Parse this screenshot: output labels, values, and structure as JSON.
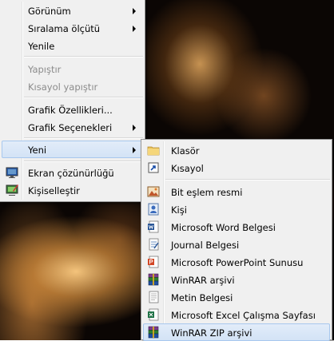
{
  "context_menu": {
    "items": [
      {
        "label": "Görünüm",
        "submenu": true
      },
      {
        "label": "Sıralama ölçütü",
        "submenu": true
      },
      {
        "label": "Yenile"
      },
      {
        "label": "Yapıştır",
        "disabled": true
      },
      {
        "label": "Kısayol yapıştır",
        "disabled": true
      },
      {
        "label": "Grafik Özellikleri..."
      },
      {
        "label": "Grafik Seçenekleri",
        "submenu": true
      },
      {
        "label": "Yeni",
        "submenu": true,
        "highlighted": true
      },
      {
        "label": "Ekran çözünürlüğü",
        "icon": "screen-resolution-icon"
      },
      {
        "label": "Kişiselleştir",
        "icon": "personalize-icon"
      }
    ]
  },
  "new_submenu": {
    "items": [
      {
        "label": "Klasör",
        "icon": "folder-icon"
      },
      {
        "label": "Kısayol",
        "icon": "shortcut-icon"
      },
      {
        "label": "Bit eşlem resmi",
        "icon": "bitmap-image-icon"
      },
      {
        "label": "Kişi",
        "icon": "contact-icon"
      },
      {
        "label": "Microsoft Word Belgesi",
        "icon": "word-document-icon"
      },
      {
        "label": "Journal Belgesi",
        "icon": "journal-document-icon"
      },
      {
        "label": "Microsoft PowerPoint Sunusu",
        "icon": "powerpoint-icon"
      },
      {
        "label": "WinRAR arşivi",
        "icon": "winrar-archive-icon"
      },
      {
        "label": "Metin Belgesi",
        "icon": "text-document-icon"
      },
      {
        "label": "Microsoft Excel Çalışma Sayfası",
        "icon": "excel-worksheet-icon"
      },
      {
        "label": "WinRAR ZIP arşivi",
        "icon": "winrar-zip-icon",
        "highlighted": true
      }
    ]
  },
  "colors": {
    "menu_background": "#f0f0f0",
    "highlight_background": "#d9e6f8",
    "highlight_border": "#a8c8ee",
    "disabled_text": "#8b8b8b"
  }
}
